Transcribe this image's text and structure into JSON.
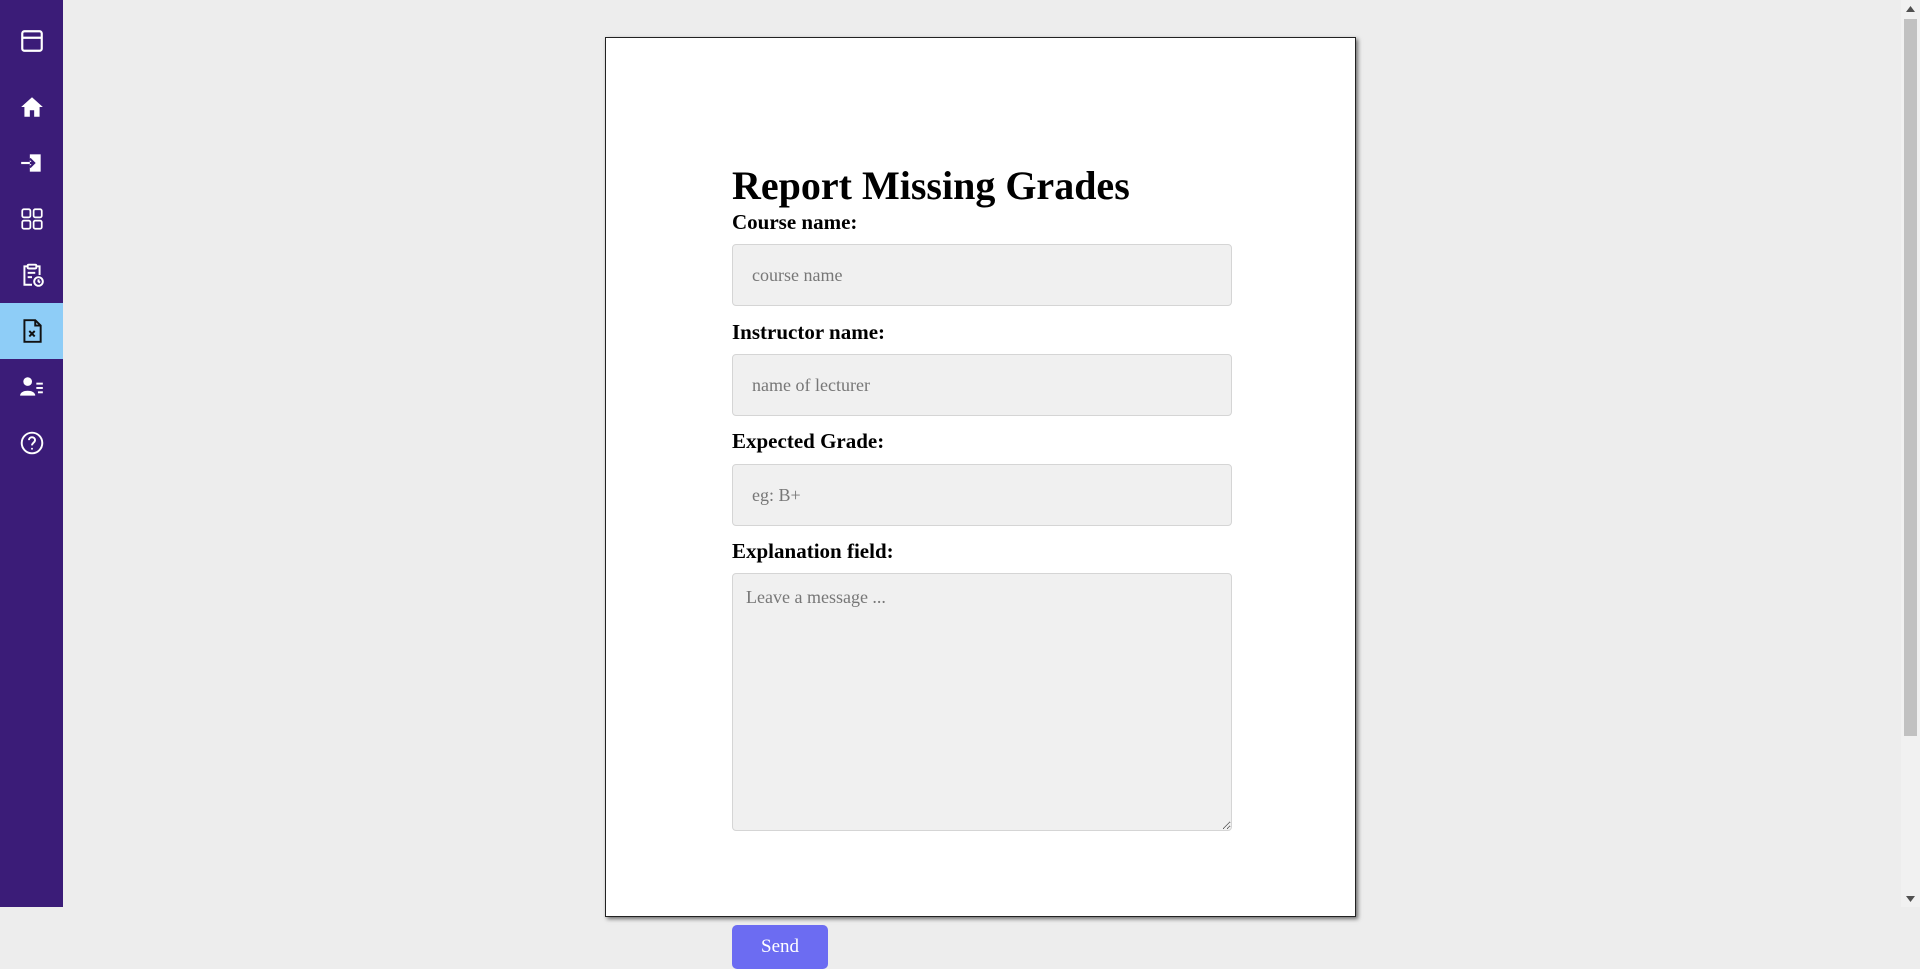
{
  "sidebar": {
    "items": [
      {
        "icon": "window-icon",
        "active": false
      },
      {
        "icon": "home-icon",
        "active": false
      },
      {
        "icon": "login-icon",
        "active": false
      },
      {
        "icon": "dashboard-grid-icon",
        "active": false
      },
      {
        "icon": "clipboard-clock-icon",
        "active": false
      },
      {
        "icon": "file-x-icon",
        "active": true
      },
      {
        "icon": "user-list-icon",
        "active": false
      },
      {
        "icon": "help-circle-icon",
        "active": false
      }
    ],
    "bg_color": "#3b1c78",
    "active_color": "#8ecdf7"
  },
  "form": {
    "title": "Report Missing Grades",
    "course": {
      "label": "Course name:",
      "placeholder": "course name",
      "value": ""
    },
    "instructor": {
      "label": "Instructor name:",
      "placeholder": "name of lecturer",
      "value": ""
    },
    "grade": {
      "label": "Expected Grade:",
      "placeholder": "eg: B+",
      "value": ""
    },
    "explanation": {
      "label": "Explanation field:",
      "placeholder": "Leave a message ...",
      "value": ""
    },
    "submit_label": "Send",
    "button_color": "#6c6cf2"
  }
}
